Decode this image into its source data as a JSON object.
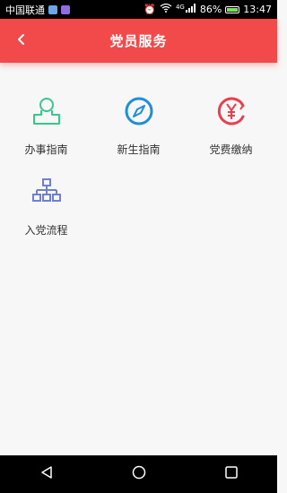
{
  "status_bar": {
    "carrier": "中国联通",
    "signal_label": "4G",
    "battery": "86%",
    "time": "13:47"
  },
  "header": {
    "title": "党员服务",
    "back_icon": "chevron-left-icon"
  },
  "colors": {
    "header": "#f24a4a",
    "green": "#36c98a",
    "blue": "#1f8fd6",
    "red": "#e8404e",
    "purple": "#6f7fd8"
  },
  "menu": [
    {
      "label": "办事指南",
      "icon": "user-icon"
    },
    {
      "label": "新生指南",
      "icon": "compass-icon"
    },
    {
      "label": "党费缴纳",
      "icon": "yuan-circle-icon"
    },
    {
      "label": "入党流程",
      "icon": "flowchart-icon"
    }
  ]
}
